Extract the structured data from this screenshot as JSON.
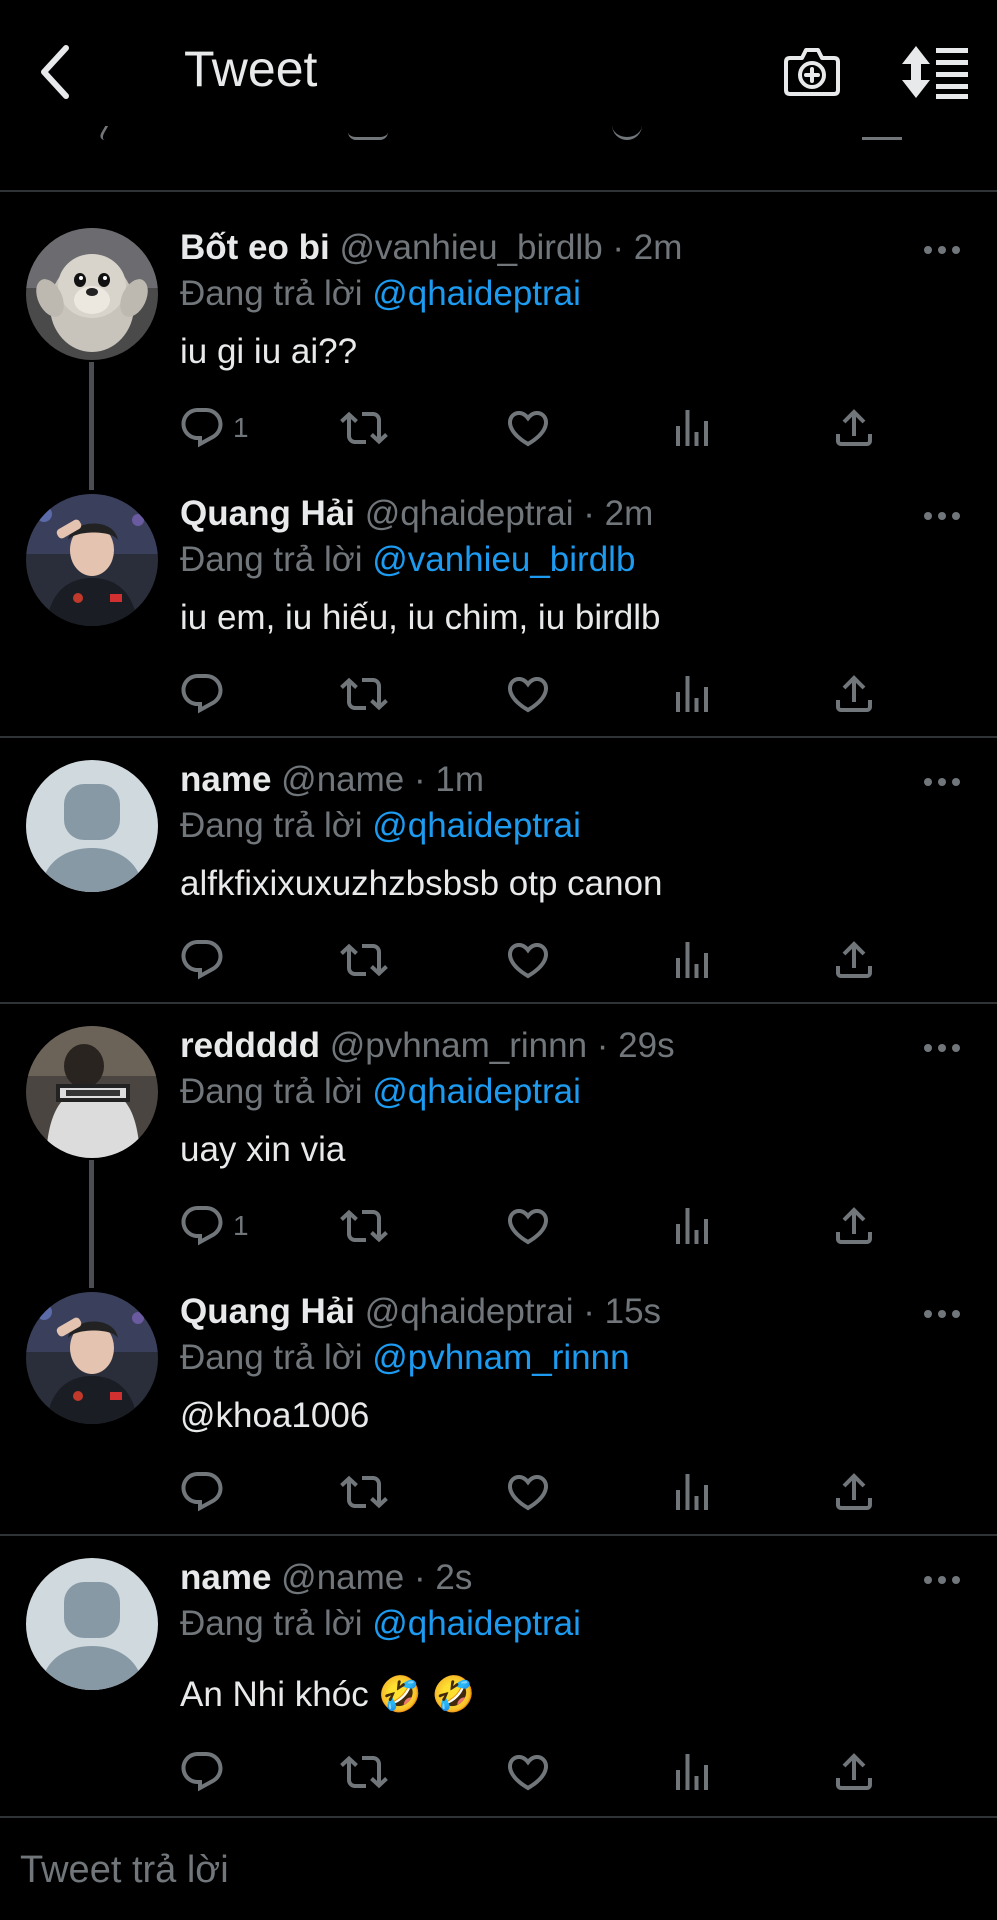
{
  "header": {
    "title": "Tweet",
    "back_icon": "chevron-left-icon",
    "camera_icon": "camera-plus-icon",
    "sort_icon": "sort-replies-icon"
  },
  "colors": {
    "background": "#000000",
    "text": "#e7e9ea",
    "muted": "#71767b",
    "link": "#1d9bf0",
    "divider": "#2f3336"
  },
  "tweets": [
    {
      "display_name": "Bốt eo bi",
      "handle": "@vanhieu_birdlb",
      "time": "· 2m",
      "reply_prefix": "Đang trả lời",
      "reply_to": "@qhaideptrai",
      "text": "iu gi iu ai??",
      "reply_count": "1",
      "avatar": "penguin-plush-avatar"
    },
    {
      "display_name": "Quang Hải",
      "handle": "@qhaideptrai",
      "time": "· 2m",
      "reply_prefix": "Đang trả lời",
      "reply_to": "@vanhieu_birdlb",
      "text": "iu em, iu hiếu, iu chim, iu birdlb",
      "reply_count": "",
      "avatar": "salute-photo-avatar"
    },
    {
      "display_name": "name",
      "handle": "@name",
      "time": "· 1m",
      "reply_prefix": "Đang trả lời",
      "reply_to": "@qhaideptrai",
      "text": "alfkfixixuxuzhzbsbsb otp canon",
      "reply_count": "",
      "avatar": "default-avatar"
    },
    {
      "display_name": "reddddd",
      "handle": "@pvhnam_rinnn",
      "time": "· 29s",
      "reply_prefix": "Đang trả lời",
      "reply_to": "@qhaideptrai",
      "text": "uay xin via",
      "reply_count": "1",
      "avatar": "jacket-photo-avatar"
    },
    {
      "display_name": "Quang Hải",
      "handle": "@qhaideptrai",
      "time": "· 15s",
      "reply_prefix": "Đang trả lời",
      "reply_to": "@pvhnam_rinnn",
      "text": "@khoa1006",
      "reply_count": "",
      "avatar": "salute-photo-avatar"
    },
    {
      "display_name": "name",
      "handle": "@name",
      "time": "· 2s",
      "reply_prefix": "Đang trả lời",
      "reply_to": "@qhaideptrai",
      "text": "An Nhi khóc 🤣 🤣",
      "reply_count": "",
      "avatar": "default-avatar"
    }
  ],
  "compose": {
    "placeholder": "Tweet trả lời"
  }
}
